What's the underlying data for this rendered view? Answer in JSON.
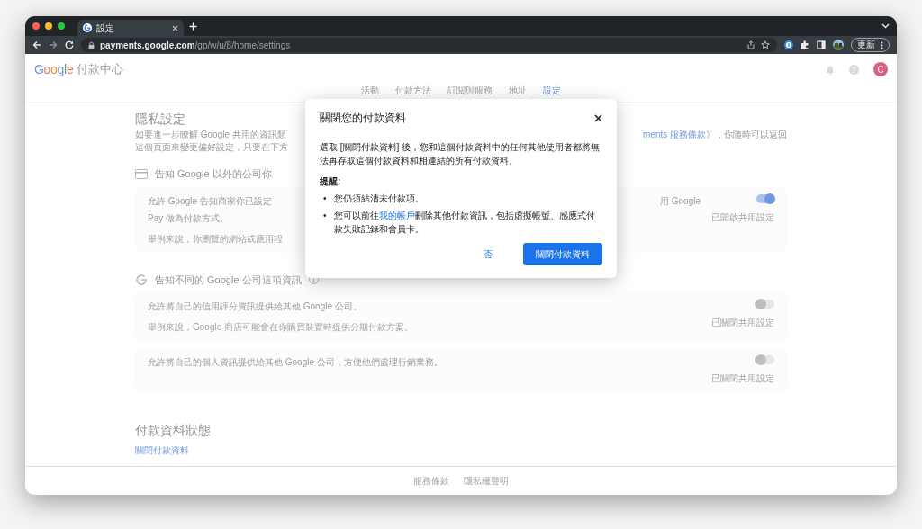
{
  "browser": {
    "tab": {
      "title": "設定",
      "selected": true
    },
    "url": {
      "host": "payments.google.com",
      "path": "/gp/w/u/8/home/settings"
    },
    "update_button": "更新"
  },
  "header": {
    "logo": "Google",
    "product": "付款中心",
    "avatar": "C"
  },
  "nav_tabs": [
    {
      "label": "活動",
      "selected": false
    },
    {
      "label": "付款方法",
      "selected": false
    },
    {
      "label": "訂閱與服務",
      "selected": false
    },
    {
      "label": "地址",
      "selected": false
    },
    {
      "label": "設定",
      "selected": true
    }
  ],
  "privacy": {
    "title": "隱私設定",
    "description": [
      {
        "left": "如要進一步瞭解 Google 共用的資訊類",
        "right_link": "ments 服務條款",
        "right": "》，你隨時可以返回"
      },
      {
        "left": "這個頁面來變更偏好設定，只要在下方"
      }
    ]
  },
  "sections": [
    {
      "heading": "告知 Google 以外的公司你",
      "settings": [
        {
          "title_lines": [
            {
              "left": "允許 Google 告知商家你已設定",
              "right": "用 Google"
            },
            {
              "left": "Pay 做為付款方式。"
            }
          ],
          "example": "舉例來說，你瀏覽的網站或應用程",
          "on": true,
          "status": "已開啟共用設定"
        }
      ]
    },
    {
      "heading": "告知不同的 Google 公司這項資訊",
      "info": true,
      "settings": [
        {
          "title_lines": [
            {
              "left": "允許將自己的信用評分資訊提供給其他 Google 公司。"
            }
          ],
          "example": "舉例來說，Google 商店可能會在你購買裝置時提供分期付款方案。",
          "on": false,
          "status": "已關閉共用設定"
        },
        {
          "title_lines": [
            {
              "left": "允許將自己的個人資訊提供給其他 Google 公司，方便他們處理行銷業務。"
            }
          ],
          "on": false,
          "status": "已關閉共用設定"
        }
      ]
    }
  ],
  "profile_status": {
    "title": "付款資料狀態",
    "link": "關閉付款資料"
  },
  "footer": [
    "服務條款",
    "隱私權聲明"
  ],
  "dialog": {
    "title": "關閉您的付款資料",
    "body": "選取 [關閉付款資料] 後，您和這個付款資料中的任何其他使用者都將無法再存取這個付款資料和相連結的所有付款資料。",
    "reminder_label": "提醒:",
    "reminders": [
      {
        "marker": "•",
        "before": "您仍須結清未付款項。"
      },
      {
        "marker": "•",
        "before": "您可以前往",
        "link": "我的帳戶",
        "after": "刪除其他付款資訊，包括虛擬帳號、感應式付款失敗記錄和會員卡。"
      }
    ],
    "cancel": "否",
    "confirm": "關閉付款資料"
  }
}
